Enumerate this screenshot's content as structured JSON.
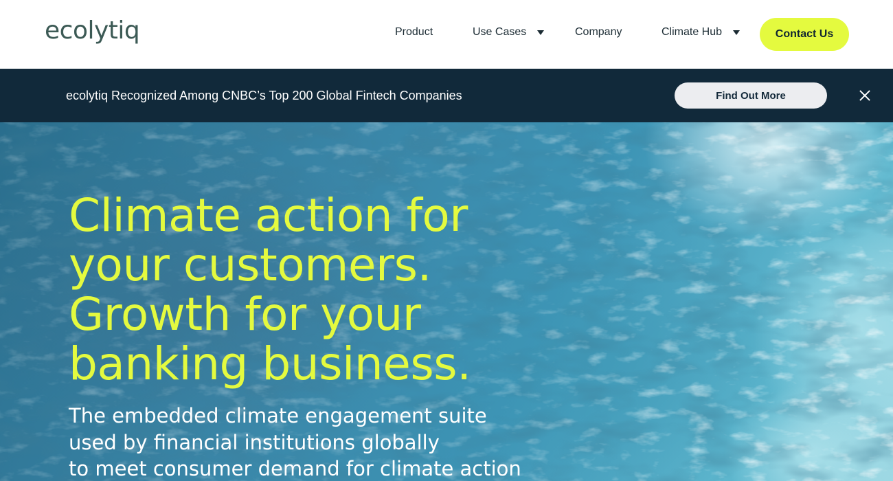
{
  "header": {
    "logo": "ecolytiq",
    "nav": [
      {
        "label": "Product"
      },
      {
        "label": "Use Cases"
      },
      {
        "label": "Company"
      },
      {
        "label": "Climate Hub"
      }
    ],
    "contact_label": "Contact Us"
  },
  "banner": {
    "text": "ecolytiq Recognized Among CNBC’s Top 200 Global Fintech Companies",
    "button_label": "Find Out More"
  },
  "hero": {
    "title_lines": [
      "Climate action for",
      "your customers.",
      "Growth for your",
      "banking business."
    ],
    "subtitle_lines": [
      "The embedded climate engagement suite",
      "used by financial institutions globally",
      "to meet consumer demand for climate action"
    ]
  },
  "colors": {
    "accent": "#e4fa3f",
    "banner_bg": "#11293a",
    "logo": "#3c5a55"
  },
  "icons": {
    "dropdown": "chevron-down-icon",
    "close": "close-icon"
  }
}
